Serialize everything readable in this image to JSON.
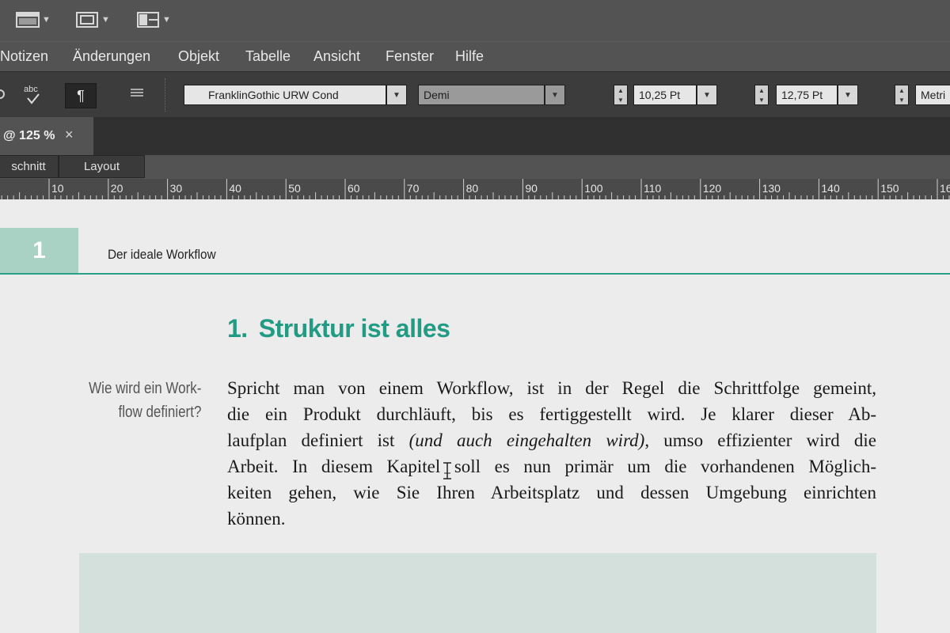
{
  "menu": [
    "Notizen",
    "Änderungen",
    "Objekt",
    "Tabelle",
    "Ansicht",
    "Fenster",
    "Hilfe"
  ],
  "control_bar": {
    "font_family": "FranklinGothic URW Cond",
    "font_style": "Demi",
    "font_size": "10,25 Pt",
    "leading": "12,75 Pt",
    "kerning": "Metri"
  },
  "document": {
    "tab_label": "@ 125 %",
    "close_glyph": "×",
    "view_tabs": [
      "schnitt",
      "Layout"
    ]
  },
  "ruler": {
    "labels": [
      "10",
      "20",
      "30",
      "40",
      "50",
      "60",
      "70",
      "80",
      "90",
      "100",
      "110",
      "120",
      "130",
      "140",
      "150",
      "16"
    ]
  },
  "page": {
    "chapter_number": "1",
    "running_head": "Der ideale Workflow",
    "heading_number": "1.",
    "heading_text": "Struktur ist alles",
    "margin_note_line1": "Wie wird ein Work-",
    "margin_note_line2": "flow definiert?",
    "body_lines": [
      "Spricht man von einem Workflow, ist in der Regel die Schrittfolge gemeint,",
      "die ein Produkt durchläuft, bis es fertiggestellt wird. Je klarer dieser Ab-",
      "laufplan definiert ist",
      "Arbeit. In diesem Kapitel soll es nun primär um die vorhandenen Möglich-",
      "keiten gehen, wie Sie Ihren Arbeitsplatz und dessen Umgebung einrichten",
      "können."
    ],
    "body_line3_italic": "(und auch eingehalten wird)",
    "body_line3_end": ", umso effizienter wird die"
  }
}
